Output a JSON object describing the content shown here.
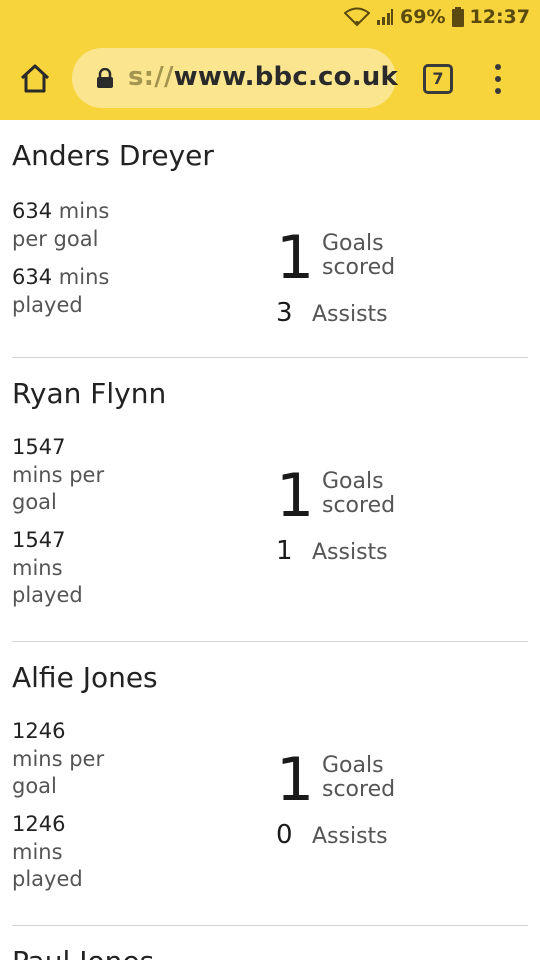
{
  "status": {
    "battery": "69%",
    "time": "12:37"
  },
  "browser": {
    "url_prefix": "s://",
    "url_domain": "www.bbc.co.uk",
    "tab_count": "7"
  },
  "players": [
    {
      "name": "Anders Dreyer",
      "mins_per_goal": "634",
      "mins_per_goal_label": "mins per goal",
      "mins_played": "634",
      "mins_played_label": "mins played",
      "goals": "1",
      "goals_label": "Goals scored",
      "assists": "3",
      "assists_label": "Assists"
    },
    {
      "name": "Ryan Flynn",
      "mins_per_goal": "1547",
      "mins_per_goal_label": "mins per goal",
      "mins_played": "1547",
      "mins_played_label": "mins played",
      "goals": "1",
      "goals_label": "Goals scored",
      "assists": "1",
      "assists_label": "Assists"
    },
    {
      "name": "Alfie Jones",
      "mins_per_goal": "1246",
      "mins_per_goal_label": "mins per goal",
      "mins_played": "1246",
      "mins_played_label": "mins played",
      "goals": "1",
      "goals_label": "Goals scored",
      "assists": "0",
      "assists_label": "Assists"
    }
  ],
  "partial_next": {
    "name": "Paul Jones"
  }
}
